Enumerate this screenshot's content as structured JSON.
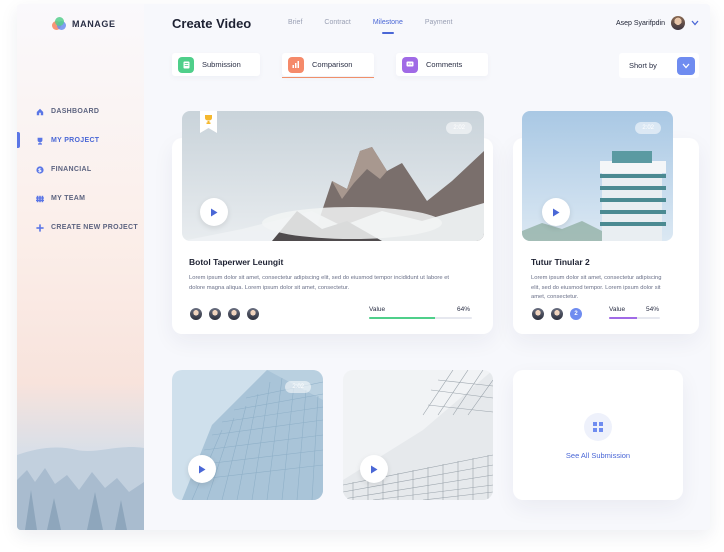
{
  "app": {
    "name": "MANAGE"
  },
  "sidebar": {
    "items": [
      {
        "label": "DASHBOARD",
        "icon": "home-icon"
      },
      {
        "label": "MY PROJECT",
        "icon": "trophy-icon",
        "active": true
      },
      {
        "label": "FINANCIAL",
        "icon": "dollar-icon"
      },
      {
        "label": "MY TEAM",
        "icon": "team-icon"
      },
      {
        "label": "CREATE NEW PROJECT",
        "icon": "plus-icon"
      }
    ]
  },
  "header": {
    "title": "Create Video",
    "tabs": [
      {
        "label": "Brief"
      },
      {
        "label": "Contract"
      },
      {
        "label": "Milestone",
        "active": true
      },
      {
        "label": "Payment"
      }
    ],
    "user": {
      "name": "Asep Syarifpdin"
    }
  },
  "filters": [
    {
      "label": "Submission",
      "color": "#4fcf8a",
      "icon": "document-icon"
    },
    {
      "label": "Comparison",
      "color": "#f58a6a",
      "icon": "chart-icon",
      "active": true
    },
    {
      "label": "Comments",
      "color": "#a06ae6",
      "icon": "comment-icon"
    }
  ],
  "sort": {
    "label": "Short by"
  },
  "cards": [
    {
      "badge": "2:02",
      "title": "Botol Taperwer Leungit",
      "desc": "Lorem ipsum dolor sit amet, consectetur adipiscing elit, sed do eiusmod tempor incididunt ut labore et dolore magna aliqua. Lorem ipsum dolor sit amet, consectetur.",
      "value_label": "Value",
      "value_text": "64%",
      "value": 0.64,
      "bar_color": "#4fcf8a"
    },
    {
      "badge": "2:02",
      "title": "Tutur Tinular 2",
      "desc": "Lorem ipsum dolor sit amet, consectetur adipiscing elit, sed do eiusmod tempor. Lorem ipsum dolor sit amet, consectetur.",
      "value_label": "Value",
      "value_text": "54%",
      "value": 0.54,
      "bar_color": "#a06ae6",
      "extra_members": "2"
    }
  ],
  "bottom": {
    "badge": "2:02",
    "see_all": "See All Submission"
  }
}
